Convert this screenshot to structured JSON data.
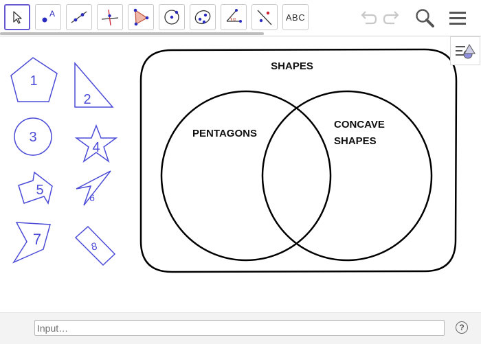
{
  "toolbar": {
    "tools": [
      {
        "name": "move-tool"
      },
      {
        "name": "point-tool",
        "label": "A"
      },
      {
        "name": "line-tool"
      },
      {
        "name": "perpendicular-line-tool"
      },
      {
        "name": "polygon-tool"
      },
      {
        "name": "circle-center-point-tool"
      },
      {
        "name": "conic-through-points-tool"
      },
      {
        "name": "angle-tool"
      },
      {
        "name": "reflect-tool"
      },
      {
        "name": "text-tool",
        "label": "ABC"
      }
    ],
    "undo_icon": "undo-icon",
    "redo_icon": "redo-icon",
    "search_icon": "search-icon",
    "menu_icon": "menu-icon"
  },
  "shapes": [
    {
      "number": "1",
      "kind": "pentagon"
    },
    {
      "number": "2",
      "kind": "right-triangle"
    },
    {
      "number": "3",
      "kind": "circle"
    },
    {
      "number": "4",
      "kind": "star"
    },
    {
      "number": "5",
      "kind": "arrow-shape"
    },
    {
      "number": "6",
      "kind": "arrowhead"
    },
    {
      "number": "7",
      "kind": "concave-pentagon"
    },
    {
      "number": "8",
      "kind": "rectangle"
    }
  ],
  "venn": {
    "universe_label": "SHAPES",
    "left_label": "PENTAGONS",
    "right_label_line1": "CONCAVE",
    "right_label_line2": "SHAPES"
  },
  "input_bar": {
    "placeholder": "Input…",
    "value": "",
    "help_label": "?"
  },
  "colors": {
    "shape_stroke": "#4b4bd8",
    "venn_stroke": "#000000",
    "selected_tool_border": "#6557d2"
  }
}
